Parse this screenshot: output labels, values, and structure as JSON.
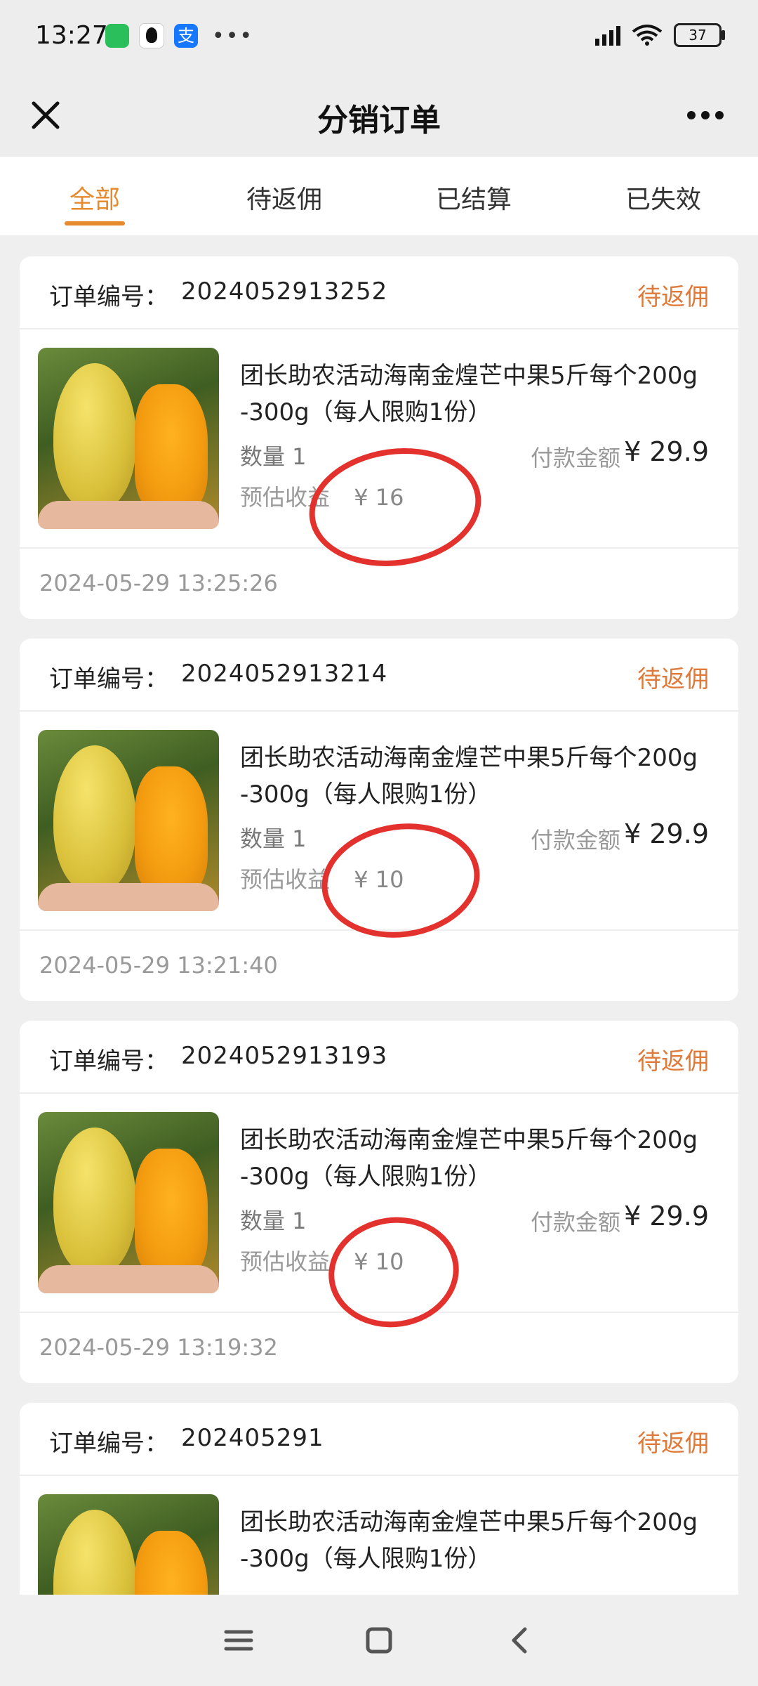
{
  "status_bar": {
    "time": "13:27",
    "battery": "37"
  },
  "header": {
    "title": "分销订单"
  },
  "tabs": [
    {
      "label": "全部",
      "active": true
    },
    {
      "label": "待返佣",
      "active": false
    },
    {
      "label": "已结算",
      "active": false
    },
    {
      "label": "已失效",
      "active": false
    }
  ],
  "orders": [
    {
      "order_label": "订单编号：",
      "order_no": "2024052913252",
      "status": "待返佣",
      "product_title": "团长助农活动海南金煌芒中果5斤每个200g -300g（每人限购1份）",
      "qty_text": "数量 1",
      "pay_label": "付款金额",
      "pay_amount": "¥ 29.9",
      "est_label": "预估收益",
      "est_amount": "¥ 16",
      "time": "2024-05-29 13:25:26"
    },
    {
      "order_label": "订单编号：",
      "order_no": "2024052913214",
      "status": "待返佣",
      "product_title": "团长助农活动海南金煌芒中果5斤每个200g -300g（每人限购1份）",
      "qty_text": "数量 1",
      "pay_label": "付款金额",
      "pay_amount": "¥ 29.9",
      "est_label": "预估收益",
      "est_amount": "¥ 10",
      "time": "2024-05-29 13:21:40"
    },
    {
      "order_label": "订单编号：",
      "order_no": "2024052913193",
      "status": "待返佣",
      "product_title": "团长助农活动海南金煌芒中果5斤每个200g -300g（每人限购1份）",
      "qty_text": "数量 1",
      "pay_label": "付款金额",
      "pay_amount": "¥ 29.9",
      "est_label": "预估收益",
      "est_amount": "¥ 10",
      "time": "2024-05-29 13:19:32"
    },
    {
      "order_label": "订单编号：",
      "order_no": "202405291",
      "status": "待返佣",
      "product_title": "团长助农活动海南金煌芒中果5斤每个200g -300g（每人限购1份）"
    }
  ],
  "colors": {
    "accent": "#e68a2e",
    "status": "#e07a3a",
    "annotation": "#e3312d"
  }
}
